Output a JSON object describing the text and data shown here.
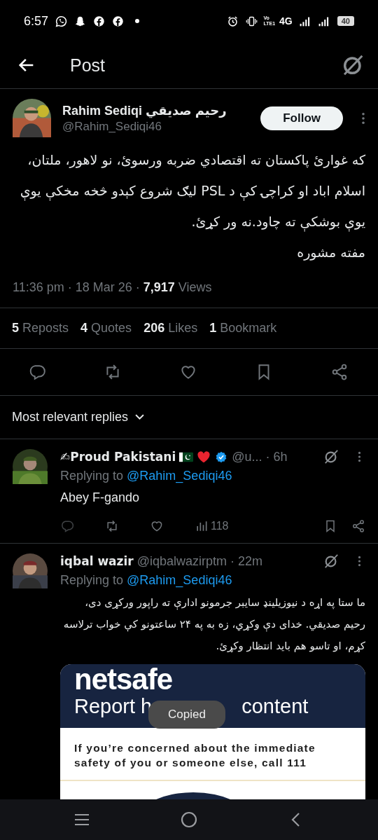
{
  "status_bar": {
    "time": "6:57",
    "volte_top": "Vo",
    "volte_bottom": "LTE1",
    "network": "4G",
    "battery": "40"
  },
  "header": {
    "title": "Post"
  },
  "post": {
    "author_name": "Rahim Sediqi رحيم صديقي",
    "handle": "@Rahim_Sediqi46",
    "follow_button": "Follow",
    "paragraphs": [
      "كه غوارئ پاكستان ته اقتصادي ضربه ورسوئ، نو لاهور، ملتان، اسلام اباد او كراچۍ کې د PSL ليګ شروع کېدو څخه مخکې يوې يوې بوشکې ته چاود.نه ور کړئ.",
      "مفته مشوره"
    ],
    "meta": "11:36 pm · 18 Mar 26 · **7,917** Views",
    "stats": [
      {
        "count": "5",
        "label": "Reposts"
      },
      {
        "count": "4",
        "label": "Quotes"
      },
      {
        "count": "206",
        "label": "Likes"
      },
      {
        "count": "1",
        "label": "Bookmark"
      }
    ]
  },
  "sort_label": "Most relevant replies",
  "replies": [
    {
      "name": "✍Proud Pakistani",
      "emoji": [
        {
          "kind": "flag"
        },
        {
          "kind": "heart"
        }
      ],
      "verified": true,
      "handle": "@u...",
      "time": "· 6h",
      "replying_label": "Replying to",
      "replying_handle": "@Rahim_Sediqi46",
      "text": "Abey F-gando",
      "rtl": false,
      "views": "118"
    },
    {
      "name": "iqbal wazir",
      "verified": false,
      "handle": "@iqbalwazirptm",
      "time": "· 22m",
      "replying_label": "Replying to",
      "replying_handle": "@Rahim_Sediqi46",
      "text": "ما ستا په اړه د نيوزيلينډ سايبر جرمونو ادارې ته راپور ورکړی دی، رحيم صديقي. خدای دې وکړي، زه به په ۲۴ ساعتونو کې خواب ترلاسه کړم، او تاسو هم بايد انتظار وکړئ.",
      "rtl": true,
      "media": {
        "kind": "web_screenshot",
        "logo": "netsafe",
        "title_start": "Report h",
        "title_end": "content",
        "notice": "If you’re concerned about the immediate safety of you or someone else, call 111"
      }
    }
  ],
  "toast": "Copied"
}
